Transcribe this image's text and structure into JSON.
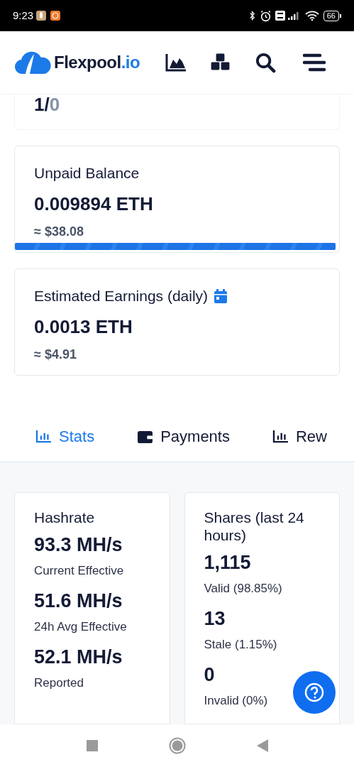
{
  "status_bar": {
    "time": "9:23",
    "battery": "66"
  },
  "header": {
    "brand": "Flexpool",
    "brand_suffix": ".io"
  },
  "top_card": {
    "value_main": "1/",
    "value_muted": "0"
  },
  "balance_cards": [
    {
      "title": "Unpaid Balance",
      "calendar": false,
      "value": "0.009894 ETH",
      "fiat": "≈ $38.08",
      "level": 1.0
    },
    {
      "title": "Estimated Earnings (daily)",
      "calendar": true,
      "value": "0.0013 ETH",
      "fiat": "≈ $4.91"
    }
  ],
  "tabs": [
    {
      "label": "Stats",
      "kind": "chart",
      "selected": true
    },
    {
      "label": "Payments",
      "kind": "wallet",
      "selected": false
    },
    {
      "label": "Rew",
      "kind": "chart",
      "selected": false
    }
  ],
  "stat_cards": [
    {
      "title": "Hashrate",
      "metrics": [
        {
          "value": "93.3 MH/s",
          "label": "Current Effective"
        },
        {
          "value": "51.6 MH/s",
          "label": "24h Avg Effective"
        },
        {
          "value": "52.1 MH/s",
          "label": "Reported"
        }
      ]
    },
    {
      "title": "Shares (last 24 hours)",
      "metrics": [
        {
          "value": "1,115",
          "label": "Valid (98.85%)"
        },
        {
          "value": "13",
          "label": "Stale (1.15%)"
        },
        {
          "value": "0",
          "label": "Invalid (0%)"
        }
      ]
    }
  ]
}
